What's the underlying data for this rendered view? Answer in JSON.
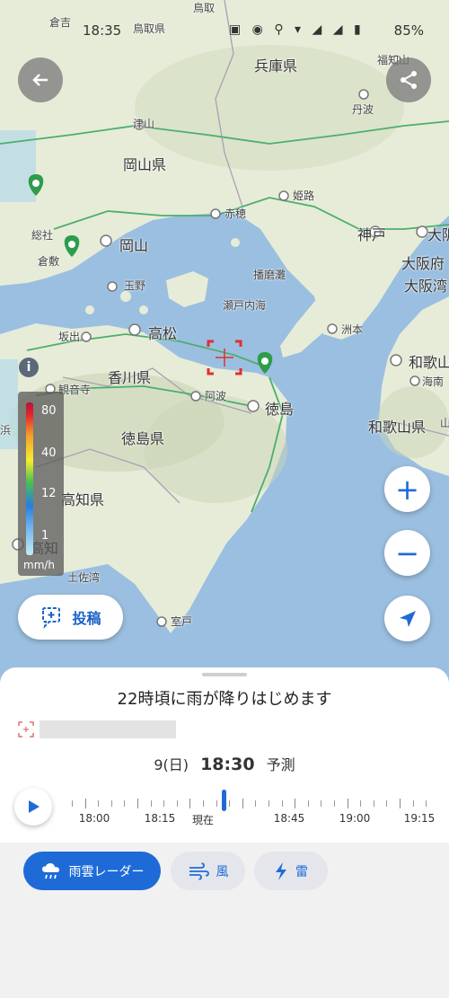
{
  "status_bar": {
    "time": "18:35",
    "battery": "85%"
  },
  "map": {
    "labels_large": [
      {
        "text": "兵庫県"
      },
      {
        "text": "岡山県"
      },
      {
        "text": "岡山"
      },
      {
        "text": "高松"
      },
      {
        "text": "香川県"
      },
      {
        "text": "徳島県"
      },
      {
        "text": "徳島"
      },
      {
        "text": "高知県"
      },
      {
        "text": "高知"
      },
      {
        "text": "神戸"
      },
      {
        "text": "大阪"
      },
      {
        "text": "和歌山"
      },
      {
        "text": "和歌山県"
      },
      {
        "text": "大阪府"
      },
      {
        "text": "大阪湾"
      }
    ],
    "labels_small": [
      {
        "text": "倉吉"
      },
      {
        "text": "鳥取"
      },
      {
        "text": "鳥取県"
      },
      {
        "text": "福知山"
      },
      {
        "text": "丹波"
      },
      {
        "text": "津山"
      },
      {
        "text": "姫路"
      },
      {
        "text": "赤穂"
      },
      {
        "text": "総社"
      },
      {
        "text": "倉敷"
      },
      {
        "text": "玉野"
      },
      {
        "text": "播磨灘"
      },
      {
        "text": "瀬戸内海"
      },
      {
        "text": "洲本"
      },
      {
        "text": "坂出"
      },
      {
        "text": "観音寺"
      },
      {
        "text": "阿波"
      },
      {
        "text": "海南"
      },
      {
        "text": "室戸"
      },
      {
        "text": "土佐湾"
      },
      {
        "text": "浜"
      },
      {
        "text": "山"
      }
    ]
  },
  "legend": {
    "levels": [
      "80",
      "40",
      "12",
      "1"
    ],
    "unit": "mm/h"
  },
  "post_button": {
    "label": "投稿"
  },
  "colors": {
    "accent": "#1e6bd8",
    "sea": "#9bbfe0",
    "land": "#e6ecd8"
  },
  "sheet": {
    "headline": "22時頃に雨が降りはじめます",
    "date": "9(日)",
    "time": "18:30",
    "mode": "予測",
    "timeline_labels": [
      "18:00",
      "18:15",
      "現在",
      "18:45",
      "19:00",
      "19:15"
    ]
  },
  "tabs": [
    {
      "label": "雨雲レーダー",
      "icon": "cloud-rain-icon",
      "active": true
    },
    {
      "label": "風",
      "icon": "wind-icon",
      "active": false
    },
    {
      "label": "雷",
      "icon": "lightning-icon",
      "active": false
    }
  ]
}
